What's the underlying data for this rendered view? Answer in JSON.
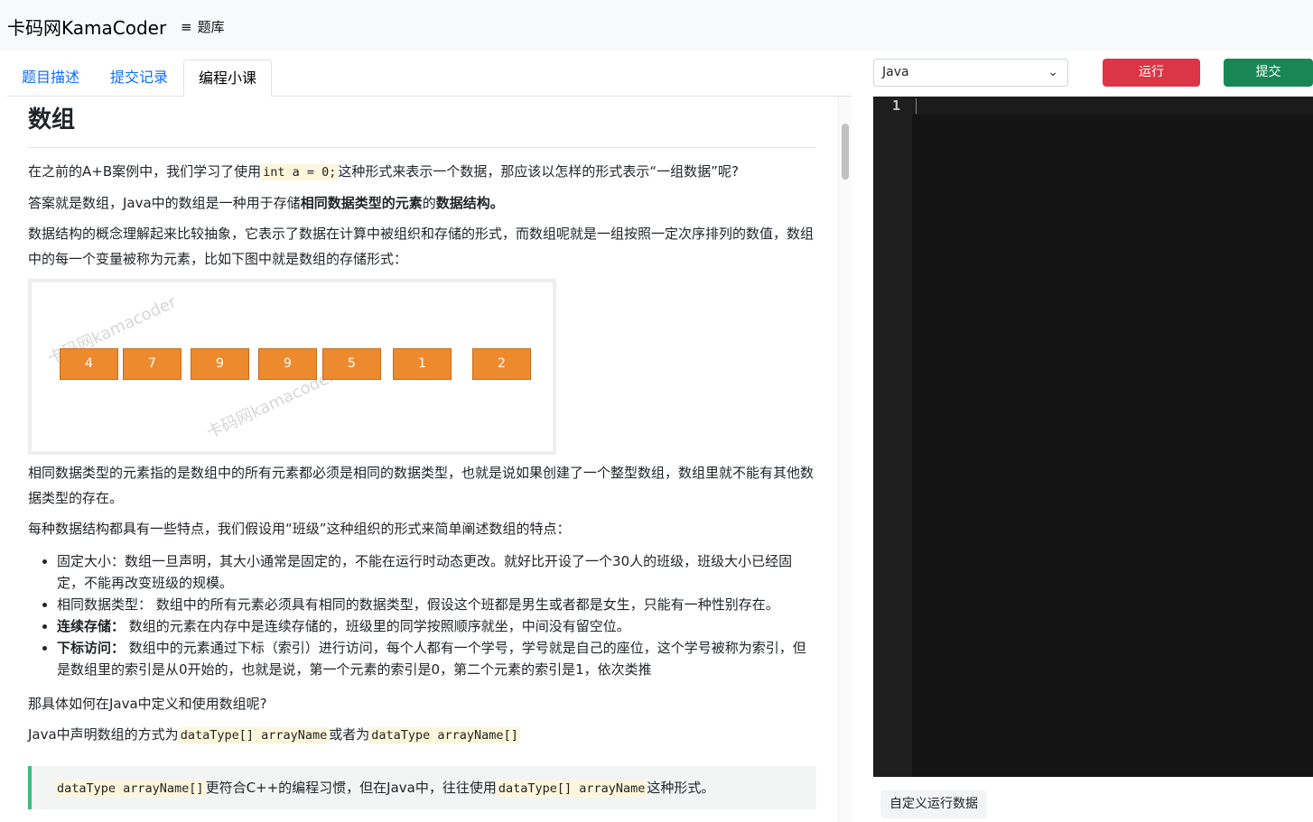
{
  "navbar": {
    "brand": "卡码网KamaCoder",
    "menu_icon": "hamburger-icon",
    "menu_label": "题库"
  },
  "tabs": [
    {
      "label": "题目描述",
      "active": false
    },
    {
      "label": "提交记录",
      "active": false
    },
    {
      "label": "编程小课",
      "active": true
    }
  ],
  "article": {
    "title": "数组",
    "p1_a": "在之前的A+B案例中，我们学习了使用",
    "p1_code": "int a = 0;",
    "p1_b": "这种形式来表示一个数据，那应该以怎样的形式表示“一组数据”呢?",
    "p2_a": "答案就是数组，Java中的数组是一种用于存储",
    "p2_bold1": "相同数据类型的元素",
    "p2_b": "的",
    "p2_bold2": "数据结构。",
    "p3": "数据结构的概念理解起来比较抽象，它表示了数据在计算中被组织和存储的形式，而数组呢就是一组按照一定次序排列的数值，数组中的每一个变量被称为元素，比如下图中就是数组的存储形式：",
    "figure_cells": [
      "4",
      "7",
      "9",
      "9",
      "5",
      "1",
      "2"
    ],
    "figure_watermark": "卡码网kamacoder",
    "p4": "相同数据类型的元素指的是数组中的所有元素都必须是相同的数据类型，也就是说如果创建了一个整型数组，数组里就不能有其他数据类型的存在。",
    "p5": "每种数据结构都具有一些特点，我们假设用“班级”这种组织的形式来简单阐述数组的特点：",
    "bullets": [
      {
        "term": "固定大小：",
        "bold": false,
        "text": "数组一旦声明，其大小通常是固定的，不能在运行时动态更改。就好比开设了一个30人的班级，班级大小已经固定，不能再改变班级的规模。"
      },
      {
        "term": "相同数据类型：",
        "bold": false,
        "text": " 数组中的所有元素必须具有相同的数据类型，假设这个班都是男生或者都是女生，只能有一种性别存在。"
      },
      {
        "term": "连续存储：",
        "bold": true,
        "text": " 数组的元素在内存中是连续存储的，班级里的同学按照顺序就坐，中间没有留空位。"
      },
      {
        "term": "下标访问：",
        "bold": true,
        "text": " 数组中的元素通过下标（索引）进行访问，每个人都有一个学号，学号就是自己的座位，这个学号被称为索引，但是数组里的索引是从0开始的，也就是说，第一个元素的索引是0，第二个元素的索引是1，依次类推"
      }
    ],
    "p6": "那具体如何在Java中定义和使用数组呢?",
    "p7_a": "Java中声明数组的方式为",
    "p7_code1": "dataType[] arrayName",
    "p7_b": "或者为",
    "p7_code2": "dataType arrayName[]",
    "quote_code1": "dataType arrayName[]",
    "quote_a": "更符合C++的编程习惯，但在Java中，往往使用",
    "quote_code2": "dataType[] arrayName",
    "quote_b": "这种形式。"
  },
  "editor": {
    "language": "Java",
    "run_label": "运行",
    "submit_label": "提交",
    "line_number": "1",
    "custom_input_label": "自定义运行数据"
  },
  "colors": {
    "run": "#dc3545",
    "submit": "#198754",
    "cell": "#ee8a2e",
    "link": "#0d6efd"
  }
}
